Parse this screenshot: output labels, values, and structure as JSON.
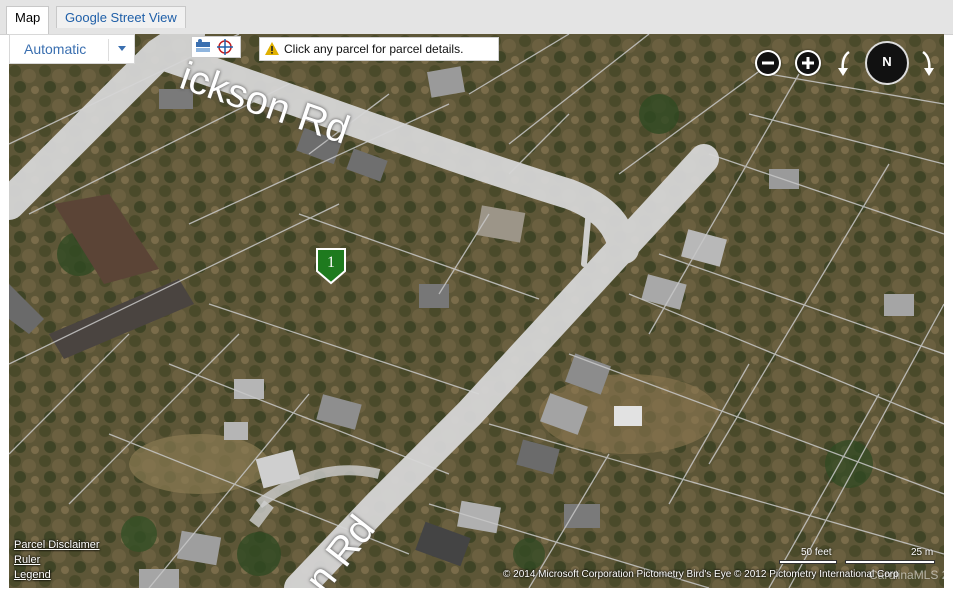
{
  "tabs": [
    {
      "label": "Map",
      "active": true
    },
    {
      "label": "Google Street View",
      "active": false
    }
  ],
  "map_mode": {
    "selected": "Automatic"
  },
  "notice": {
    "text": "Click any parcel for parcel details."
  },
  "streets": [
    {
      "label": "ickson Rd"
    },
    {
      "label": "n Rd"
    }
  ],
  "marker": {
    "label": "1",
    "color": "#1e7a1e"
  },
  "bottom_links": [
    "Parcel Disclaimer",
    "Ruler",
    "Legend"
  ],
  "scale": {
    "feet_label": "50 feet",
    "meters_label": "25 m"
  },
  "copyright": "© 2014 Microsoft Corporation   Pictometry Bird's Eye © 2012 Pictometry International Corp",
  "watermark": "CarolinaMLS 2014",
  "compass": {
    "label": "N"
  },
  "colors": {
    "accent": "#1f5fa8",
    "road": "#d9d9d9",
    "marker": "#1e7a1e"
  }
}
